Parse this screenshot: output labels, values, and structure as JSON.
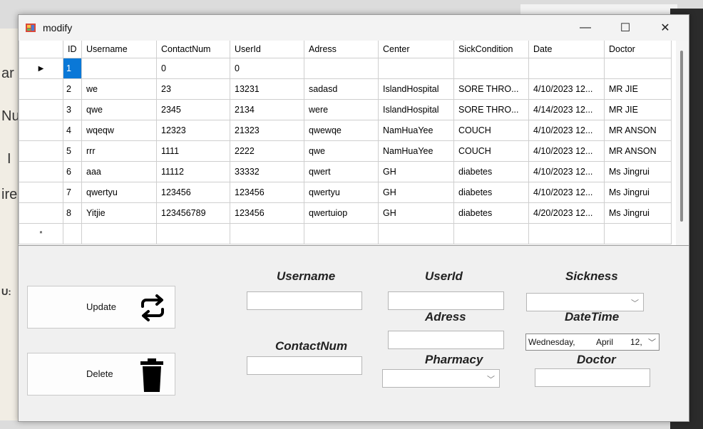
{
  "window": {
    "title": "modify",
    "minimize_glyph": "—",
    "maximize_glyph": "☐",
    "close_glyph": "✕"
  },
  "background_fragments": [
    "ar",
    "Nu",
    "I",
    "ire",
    "U:"
  ],
  "grid": {
    "columns": [
      "ID",
      "Username",
      "ContactNum",
      "UserId",
      "Adress",
      "Center",
      "SickCondition",
      "Date",
      "Doctor"
    ],
    "rows": [
      {
        "indicator": "▶",
        "cells": [
          "1",
          "",
          "0",
          "0",
          "",
          "",
          "",
          "",
          ""
        ]
      },
      {
        "indicator": "",
        "cells": [
          "2",
          "we",
          "23",
          "13231",
          "sadasd",
          "IslandHospital",
          "SORE THRO...",
          "4/10/2023 12...",
          "MR JIE"
        ]
      },
      {
        "indicator": "",
        "cells": [
          "3",
          "qwe",
          "2345",
          "2134",
          "were",
          "IslandHospital",
          "SORE THRO...",
          "4/14/2023 12...",
          "MR JIE"
        ]
      },
      {
        "indicator": "",
        "cells": [
          "4",
          "wqeqw",
          "12323",
          "21323",
          "qwewqe",
          "NamHuaYee",
          "COUCH",
          "4/10/2023 12...",
          "MR ANSON"
        ]
      },
      {
        "indicator": "",
        "cells": [
          "5",
          "rrr",
          "1111",
          "2222",
          "qwe",
          "NamHuaYee",
          "COUCH",
          "4/10/2023 12...",
          "MR ANSON"
        ]
      },
      {
        "indicator": "",
        "cells": [
          "6",
          "aaa",
          "11112",
          "33332",
          "qwert",
          "GH",
          "diabetes",
          "4/10/2023 12...",
          "Ms Jingrui"
        ]
      },
      {
        "indicator": "",
        "cells": [
          "7",
          "qwertyu",
          "123456",
          "123456",
          "qwertyu",
          "GH",
          "diabetes",
          "4/10/2023 12...",
          "Ms Jingrui"
        ]
      },
      {
        "indicator": "",
        "cells": [
          "8",
          "Yitjie",
          "123456789",
          "123456",
          "qwertuiop",
          "GH",
          "diabetes",
          "4/20/2023 12...",
          "Ms Jingrui"
        ]
      },
      {
        "indicator": "*",
        "cells": [
          "",
          "",
          "",
          "",
          "",
          "",
          "",
          "",
          ""
        ]
      }
    ],
    "selected_row": 0,
    "selected_col": 0
  },
  "form": {
    "update_label": "Update",
    "delete_label": "Delete",
    "username_label": "Username",
    "contactnum_label": "ContactNum",
    "userid_label": "UserId",
    "adress_label": "Adress",
    "pharmacy_label": "Pharmacy",
    "sickness_label": "Sickness",
    "datetime_label": "DateTime",
    "doctor_label": "Doctor",
    "date_picker": {
      "day": "Wednesday,",
      "month": "April",
      "date": "12,"
    }
  },
  "colors": {
    "selection": "#0a78d7"
  }
}
